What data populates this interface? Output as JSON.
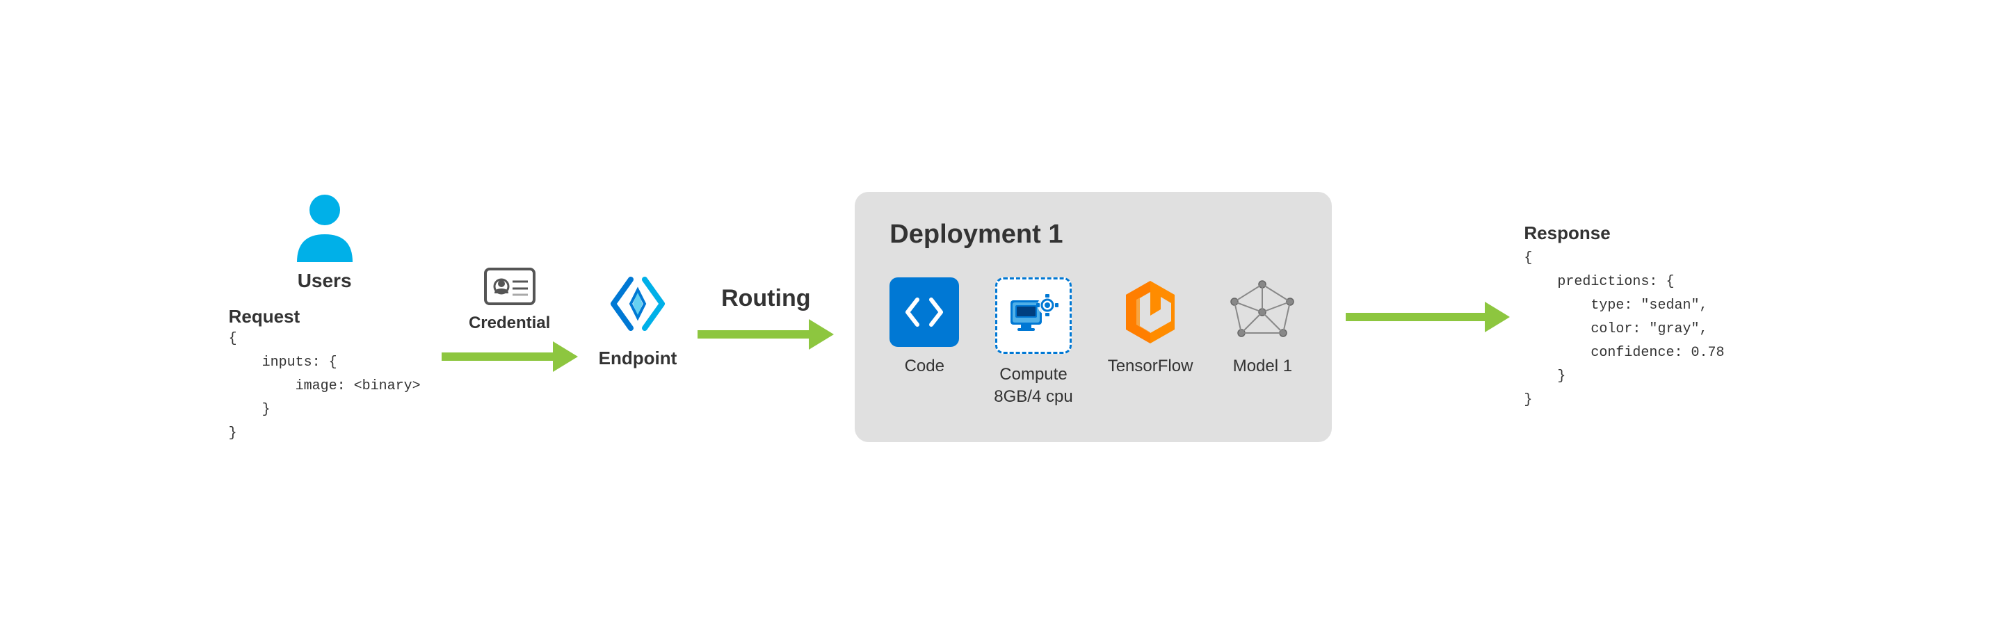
{
  "users": {
    "label": "Users",
    "icon": "user-icon"
  },
  "request": {
    "label": "Request",
    "code_lines": [
      "{",
      "    inputs: {",
      "        image: <binary>",
      "    }",
      "}"
    ]
  },
  "credential": {
    "label": "Credential",
    "icon": "credential-icon"
  },
  "endpoint": {
    "label": "Endpoint",
    "icon": "endpoint-icon"
  },
  "routing": {
    "label": "Routing"
  },
  "deployment": {
    "title": "Deployment 1",
    "items": [
      {
        "id": "code",
        "label": "Code"
      },
      {
        "id": "compute",
        "label": "Compute\n8GB/4 cpu"
      },
      {
        "id": "tensorflow",
        "label": "TensorFlow"
      },
      {
        "id": "model1",
        "label": "Model 1"
      }
    ]
  },
  "response": {
    "label": "Response",
    "code_lines": [
      "{",
      "    predictions: {",
      "        type: \"sedan\",",
      "        color: \"gray\",",
      "        confidence: 0.78",
      "    }",
      "}"
    ]
  },
  "colors": {
    "green_arrow": "#8dc63f",
    "azure_blue": "#0078d4",
    "background": "#ffffff",
    "deployment_bg": "#e8e8e8"
  }
}
